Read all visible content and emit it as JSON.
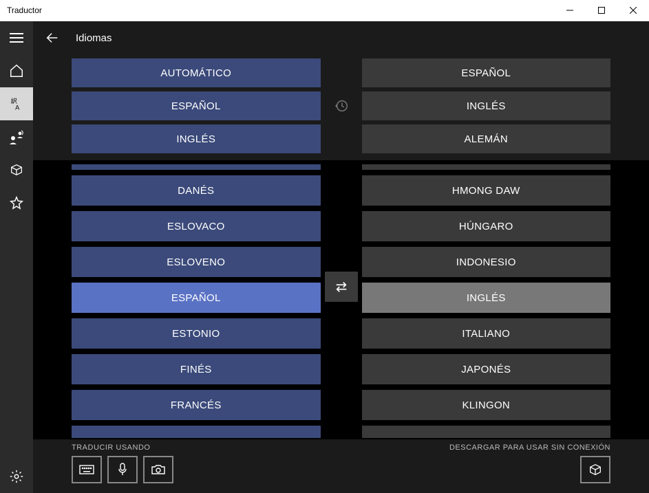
{
  "window": {
    "title": "Traductor"
  },
  "page": {
    "title": "Idiomas"
  },
  "top_source": [
    "AUTOMÁTICO",
    "ESPAÑOL",
    "INGLÉS"
  ],
  "top_target": [
    "ESPAÑOL",
    "INGLÉS",
    "ALEMÁN"
  ],
  "source_list": {
    "items": [
      "DANÉS",
      "ESLOVACO",
      "ESLOVENO",
      "ESPAÑOL",
      "ESTONIO",
      "FINÉS",
      "FRANCÉS"
    ],
    "selected_index": 3
  },
  "target_list": {
    "items": [
      "HMONG DAW",
      "HÚNGARO",
      "INDONESIO",
      "INGLÉS",
      "ITALIANO",
      "JAPONÉS",
      "KLINGON"
    ],
    "selected_index": 3
  },
  "bottom": {
    "translate_using": "TRADUCIR USANDO",
    "download_label": "DESCARGAR PARA USAR SIN CONEXIÓN"
  }
}
